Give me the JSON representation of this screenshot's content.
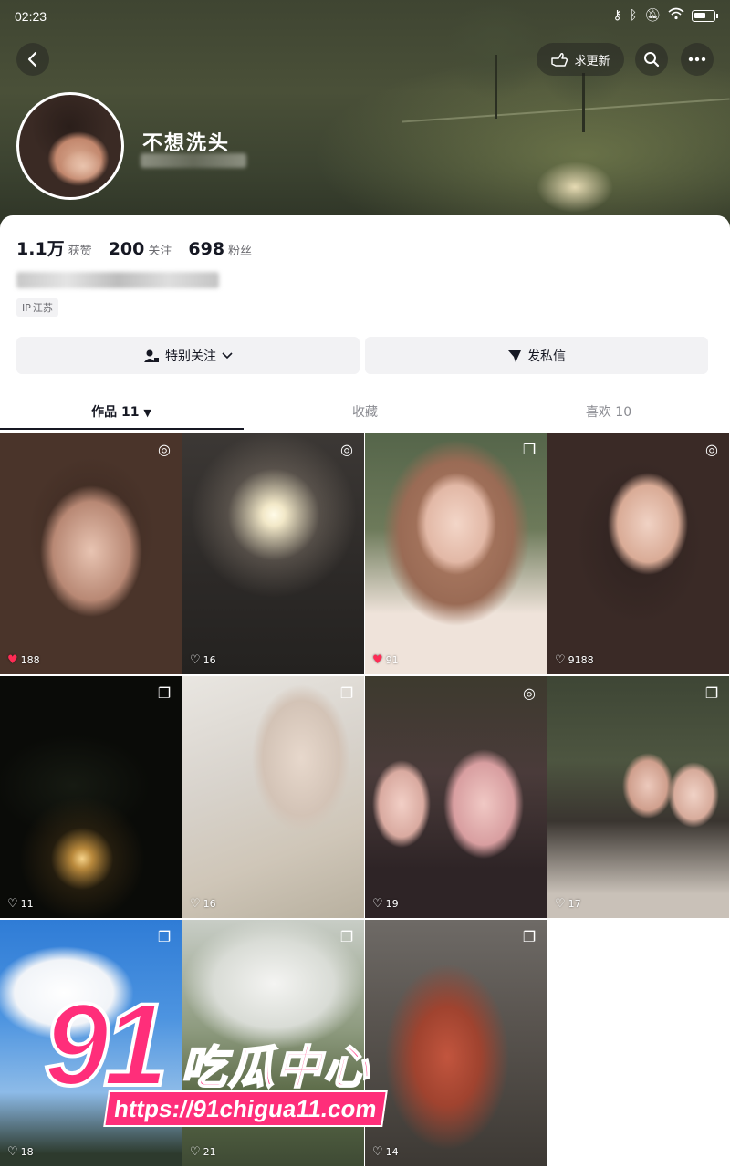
{
  "status_bar": {
    "time": "02:23"
  },
  "header": {
    "refresh_button_label": "求更新",
    "nickname": "不想洗头"
  },
  "stats": {
    "likes": {
      "value": "1.1万",
      "label": "获赞"
    },
    "following": {
      "value": "200",
      "label": "关注"
    },
    "followers": {
      "value": "698",
      "label": "粉丝"
    }
  },
  "location": {
    "prefix": "IP",
    "label": "江苏"
  },
  "actions": {
    "follow_label": "特别关注",
    "message_label": "发私信"
  },
  "tabs": [
    {
      "label": "作品 11",
      "active": true
    },
    {
      "label": "收藏",
      "active": false
    },
    {
      "label": "喜欢 10",
      "active": false
    }
  ],
  "posts": [
    {
      "likes": "188",
      "liked": true,
      "badge": "live-photo-icon"
    },
    {
      "likes": "16",
      "liked": false,
      "badge": "live-photo-icon"
    },
    {
      "likes": "91",
      "liked": true,
      "badge": "multi-image-icon"
    },
    {
      "likes": "9188",
      "liked": false,
      "badge": "live-photo-icon"
    },
    {
      "likes": "11",
      "liked": false,
      "badge": "multi-image-icon"
    },
    {
      "likes": "16",
      "liked": false,
      "badge": "multi-image-icon"
    },
    {
      "likes": "19",
      "liked": false,
      "badge": "live-photo-icon"
    },
    {
      "likes": "17",
      "liked": false,
      "badge": "multi-image-icon"
    },
    {
      "likes": "18",
      "liked": false,
      "badge": "multi-image-icon"
    },
    {
      "likes": "21",
      "liked": false,
      "badge": "multi-image-icon"
    },
    {
      "likes": "14",
      "liked": false,
      "badge": "multi-image-icon"
    }
  ],
  "watermark": {
    "number": "91",
    "text": "吃瓜中心",
    "url": "https://91chigua11.com"
  },
  "colors": {
    "like_red": "#fe2c55",
    "watermark_pink": "#ff2e7a",
    "button_bg": "#f2f2f4"
  }
}
